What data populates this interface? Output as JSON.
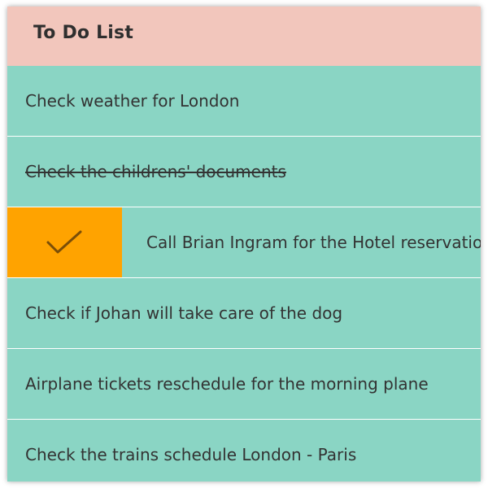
{
  "header": {
    "title": "To Do List"
  },
  "tasks": [
    {
      "label": "Check weather for London",
      "done": false
    },
    {
      "label": "Check the childrens' documents",
      "done": true
    },
    {
      "label": "Call Brian Ingram for the Hotel reservation",
      "done": false,
      "swipe_action": "check-icon"
    },
    {
      "label": "Check if Johan will take care of the dog",
      "done": false
    },
    {
      "label": "Airplane tickets reschedule for the morning plane",
      "done": false
    },
    {
      "label": "Check the trains schedule London - Paris",
      "done": false
    }
  ],
  "colors": {
    "header_bg": "#f2c6bc",
    "list_bg": "#8ad5c4",
    "swipe_action_bg": "#ffa300",
    "text": "#333333",
    "divider": "#ffffff"
  }
}
